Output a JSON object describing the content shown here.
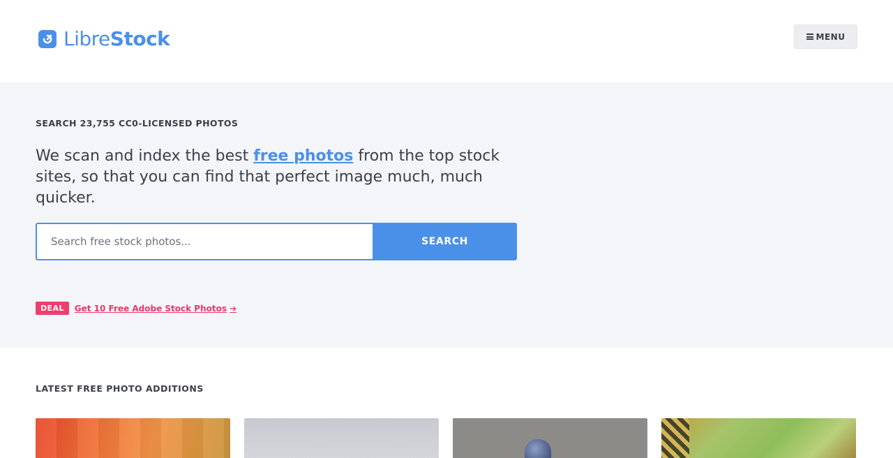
{
  "header": {
    "logo_light": "Libre",
    "logo_bold": "Stock",
    "menu_label": "MENU"
  },
  "hero": {
    "eyebrow": "SEARCH 23,755 CC0-LICENSED PHOTOS",
    "tagline_before": "We scan and index the best ",
    "tagline_link": "free photos",
    "tagline_after": " from the top stock sites, so that you can find that perfect image much, much quicker.",
    "search_placeholder": "Search free stock photos...",
    "search_button": "SEARCH",
    "deal_badge": "DEAL",
    "deal_link": "Get 10 Free Adobe Stock Photos"
  },
  "latest": {
    "title": "LATEST FREE PHOTO ADDITIONS"
  },
  "colors": {
    "accent": "#4a90e8",
    "deal": "#ef3e6e",
    "hero_bg": "#f4f5f8"
  }
}
